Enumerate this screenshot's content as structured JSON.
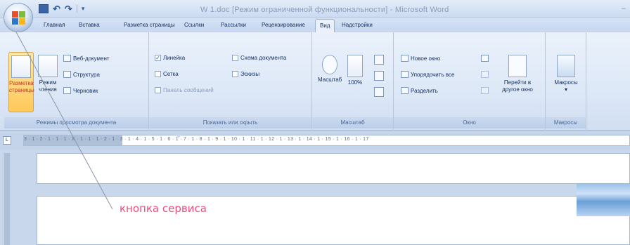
{
  "window": {
    "title": "W 1.doc [Режим ограниченной функциональности] - Microsoft Word"
  },
  "quick_access": {
    "icons": [
      "save-icon",
      "undo-icon",
      "redo-icon",
      "customize-icon"
    ]
  },
  "tabs": [
    {
      "label": "Главная"
    },
    {
      "label": "Вставка"
    },
    {
      "label": "Разметка страницы"
    },
    {
      "label": "Ссылки"
    },
    {
      "label": "Рассылки"
    },
    {
      "label": "Рецензирование"
    },
    {
      "label": "Вид",
      "active": true
    },
    {
      "label": "Надстройки"
    }
  ],
  "ribbon": {
    "views": {
      "label": "Режимы просмотра документа",
      "layout": "Разметка страницы",
      "reading": "Режим чтения",
      "web": "Веб-документ",
      "outline": "Структура",
      "draft": "Черновик"
    },
    "show_hide": {
      "label": "Показать или скрыть",
      "ruler": "Линейка",
      "ruler_checked": true,
      "grid": "Сетка",
      "message_panel": "Панель сообщений",
      "doc_map": "Схема документа",
      "thumbnails": "Эскизы"
    },
    "zoom": {
      "label": "Масштаб",
      "zoom": "Масштаб",
      "hundred": "100%"
    },
    "window": {
      "label": "Окно",
      "new_window": "Новое окно",
      "arrange_all": "Упорядочить все",
      "split": "Разделить",
      "switch_windows": "Перейти в другое окно"
    },
    "macros": {
      "label": "Макросы",
      "macros": "Макросы"
    }
  },
  "ruler": {
    "ticks": "3 · 1 · 2 · 1 · 1 · 1 · X · 1 · 1 · 1 · 2 · 1 · 3 · 1 · 4 · 1 · 5 · 1 · 6 · 1 · 7 · 1 · 8 · 1 · 9 · 1 · 10 · 1 · 11 · 1 · 12 · 1 · 13 · 1 · 14 · 1 · 15 · 1 · 16 · 1 · 17"
  },
  "annotation": {
    "text": "кнопка сервиса"
  },
  "colors": {
    "accent": "#2f5d9e",
    "annotation": "#ea4f7c",
    "highlight": "#ffc85a"
  }
}
